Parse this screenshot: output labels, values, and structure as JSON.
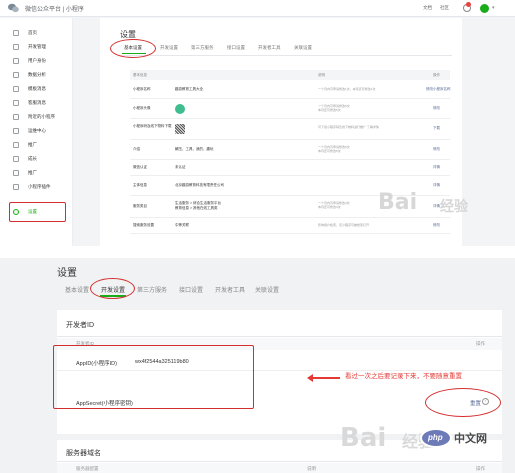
{
  "top": {
    "brand": "微信公众平台 | 小程序",
    "links": [
      "文档",
      "社区"
    ],
    "sidebar": [
      {
        "label": "首页",
        "icon": "home-icon"
      },
      {
        "label": "开发管理",
        "icon": "code-icon"
      },
      {
        "label": "用户身份",
        "icon": "user-icon"
      },
      {
        "label": "数据分析",
        "icon": "chart-icon"
      },
      {
        "label": "模板消息",
        "icon": "message-icon"
      },
      {
        "label": "客服消息",
        "icon": "service-icon"
      },
      {
        "label": "附近的小程序",
        "icon": "location-icon"
      },
      {
        "label": "运维中心",
        "icon": "wrench-icon"
      },
      {
        "label": "推广",
        "icon": "promote-icon"
      },
      {
        "label": "成长",
        "icon": "growth-icon"
      },
      {
        "label": "推广",
        "icon": "share-icon"
      },
      {
        "label": "小程序插件",
        "icon": "plugin-icon"
      },
      {
        "label": "设置",
        "icon": "settings-icon"
      }
    ],
    "title": "设置",
    "tabs": [
      "基本设置",
      "开发设置",
      "第三方服务",
      "接口设置",
      "开发者工具",
      "关联设置"
    ],
    "table_headers": [
      "基本信息",
      "说明",
      "操作"
    ],
    "rows": [
      {
        "label": "小程序名称",
        "value": "趣游教育工具大全",
        "note": "一个月内可申请修改1次，本月还可修改1次",
        "action": "修改小程序名称"
      },
      {
        "label": "小程序头像",
        "value": "",
        "note": "一个月内可申请修改5次\n本月还可修改5次",
        "action": "修改"
      },
      {
        "label": "小程序码及线下物料下载",
        "value": "",
        "note": "可下载小程序码及线下物料进行推广 了解详情",
        "action": "下载"
      },
      {
        "label": "介绍",
        "value": "解压，工具，我的，趣玩",
        "note": "一个月内可申请修改5次\n本月还可修改5次",
        "action": "修改"
      },
      {
        "label": "微信认证",
        "value": "未认证",
        "note": "",
        "action": "详情"
      },
      {
        "label": "主体信息",
        "value": "北京趣游教育科技有限责任公司",
        "note": "",
        "action": "详情"
      },
      {
        "label": "服务类目",
        "value": "生活服务 > 综合生活服务平台\n教育信息 > 其他在线工具类",
        "note": "一个月内可申请修改3次\n本月还可修改3次",
        "action": "详情"
      },
      {
        "label": "搜索服务设置",
        "value": "中等关联",
        "note": "影响用户检索，该小程序可被搜索打开",
        "action": "修改"
      }
    ],
    "watermark": "Bai",
    "watermark2": "经验"
  },
  "bottom": {
    "title": "设置",
    "tabs": [
      "基本设置",
      "开发设置",
      "第三方服务",
      "接口设置",
      "开发者工具",
      "关联设置"
    ],
    "section1": {
      "title": "开发者ID",
      "head_left": "开发者ID",
      "head_right": "操作",
      "appid_label": "AppID(小程序ID)",
      "appid_value": "wx4f2544a325119b80",
      "secret_label": "AppSecret(小程序密钥)",
      "reset": "重置",
      "help": "?"
    },
    "annotation": "看过一次之后要记录下来，不要随意重置",
    "section2": {
      "title": "服务器域名",
      "head_left": "服务器配置",
      "head_mid": "说明",
      "head_right": "操作"
    },
    "watermark": "Bai",
    "watermark2": "经验",
    "php": "php",
    "php_cn": "中文网"
  }
}
